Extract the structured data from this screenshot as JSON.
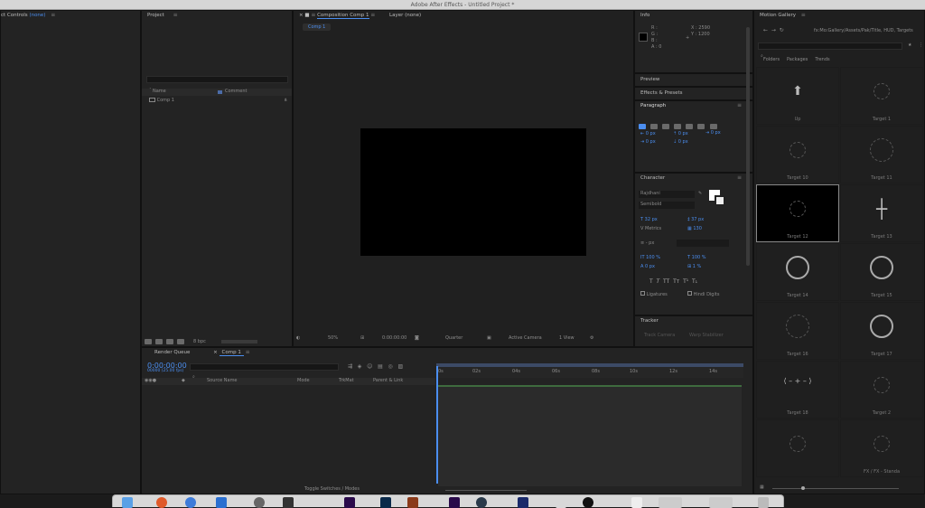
{
  "window": {
    "title": "Adobe After Effects - Untitled Project *"
  },
  "effect_controls": {
    "title": "ct Controls",
    "title_value": "(none)"
  },
  "project": {
    "title": "Project",
    "columns": {
      "name": "Name",
      "comment": "Comment"
    },
    "items": [
      {
        "name": "Comp 1"
      }
    ],
    "footer_bpc": "8 bpc"
  },
  "composition": {
    "tab_label": "Composition Comp 1",
    "layer_label": "Layer (none)",
    "subtab": "Comp 1",
    "zoom": "50%",
    "timecode": "0:00:00:00",
    "resolution": "Quarter",
    "camera": "Active Camera",
    "view": "1 View"
  },
  "info": {
    "title": "Info",
    "r": "R :",
    "g": "G :",
    "b": "B :",
    "a": "A :  0",
    "x": "X : 2590",
    "y": "Y : 1200"
  },
  "preview": {
    "title": "Preview"
  },
  "effects": {
    "title": "Effects & Presets"
  },
  "paragraph": {
    "title": "Paragraph",
    "values": [
      "0 px",
      "0 px",
      "0 px",
      "0 px",
      "0 px"
    ]
  },
  "character": {
    "title": "Character",
    "font": "Rajdhani",
    "style": "Semibold",
    "size": "32 px",
    "leading": "37 px",
    "kerning": "Metrics",
    "tracking": "130",
    "stroke": "- px",
    "v_scale": "100 %",
    "h_scale": "100 %",
    "baseline": "0 px",
    "tsume": "1 %",
    "ligatures": "Ligatures",
    "hindi": "Hindi Digits"
  },
  "tracker": {
    "title": "Tracker",
    "track_camera": "Track Camera",
    "warp": "Warp Stabilizer"
  },
  "timeline": {
    "render_queue": "Render Queue",
    "tab": "Comp 1",
    "timecode": "0:00:00:00",
    "fps": "00000 (25.00 fps)",
    "columns": {
      "source": "Source Name",
      "mode": "Mode",
      "trkmat": "TrkMat",
      "parent": "Parent & Link"
    },
    "ruler": [
      "0s",
      "02s",
      "04s",
      "06s",
      "08s",
      "10s",
      "12s",
      "14s"
    ],
    "toggle": "Toggle Switches / Modes"
  },
  "motion_gallery": {
    "title": "Motion Gallery",
    "path": "fx:Mo:Gallery/Assets/Pak/Title, HUD, Targets",
    "tabs": [
      "Folders",
      "Packages",
      "Trends"
    ],
    "items": [
      {
        "label": "Up",
        "icon": "arrow-up-icon"
      },
      {
        "label": "Target 1",
        "icon": "target-icon"
      },
      {
        "label": "Target 10",
        "icon": "target-icon"
      },
      {
        "label": "Target 11",
        "icon": "target-icon"
      },
      {
        "label": "Target 12",
        "icon": "target-icon"
      },
      {
        "label": "Target 13",
        "icon": "crosshair-icon"
      },
      {
        "label": "Target 14",
        "icon": "target-icon"
      },
      {
        "label": "Target 15",
        "icon": "target-icon"
      },
      {
        "label": "Target 16",
        "icon": "target-icon"
      },
      {
        "label": "Target 17",
        "icon": "target-icon"
      },
      {
        "label": "Target 18",
        "icon": "target-icon"
      },
      {
        "label": "Target 2",
        "icon": "target-icon"
      },
      {
        "label": "",
        "icon": "target-icon"
      },
      {
        "label": "FX / FX - Standa",
        "icon": "target-icon"
      }
    ]
  },
  "colors": {
    "accent": "#4b8ef0",
    "panel": "#232323",
    "bg": "#1b1b1b"
  }
}
